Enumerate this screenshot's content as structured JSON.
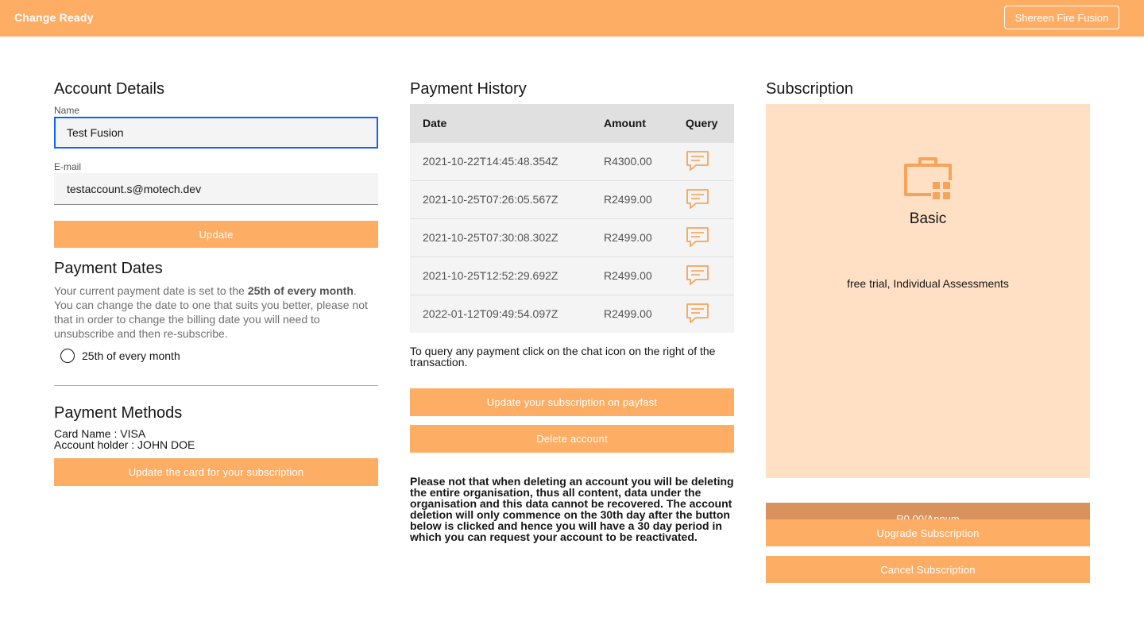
{
  "header": {
    "app_title": "Change Ready",
    "user_button": "Shereen Fire Fusion"
  },
  "account": {
    "heading": "Account Details",
    "name_label": "Name",
    "name_value": "Test Fusion",
    "email_label": "E-mail",
    "email_value": "testaccount.s@motech.dev",
    "update_button": "Update"
  },
  "payment_dates": {
    "heading": "Payment Dates",
    "text_before": "Your current payment date is set to the ",
    "text_bold": "25th of every month",
    "text_after": ". You can change the date to one that suits you better, please not that in order to change the billing date you will need to unsubscribe and then re-subscribe.",
    "option_label": "25th of every month"
  },
  "payment_methods": {
    "heading": "Payment Methods",
    "card_name": "Card Name : VISA",
    "account_holder": "Account holder : JOHN DOE",
    "update_card_button": "Update the card for your subscription"
  },
  "history": {
    "heading": "Payment History",
    "columns": [
      "Date",
      "Amount",
      "Query"
    ],
    "rows": [
      {
        "date": "2021-10-22T14:45:48.354Z",
        "amount": "R4300.00",
        "icon": "chat-icon"
      },
      {
        "date": "2021-10-25T07:26:05.567Z",
        "amount": "R2499.00",
        "icon": "chat-icon"
      },
      {
        "date": "2021-10-25T07:30:08.302Z",
        "amount": "R2499.00",
        "icon": "chat-icon"
      },
      {
        "date": "2021-10-25T12:52:29.692Z",
        "amount": "R2499.00",
        "icon": "chat-icon"
      },
      {
        "date": "2022-01-12T09:49:54.097Z",
        "amount": "R2499.00",
        "icon": "chat-icon"
      }
    ],
    "query_note": "To query any payment click on the chat icon on the right of the transaction.",
    "payfast_button": "Update your subscription on payfast",
    "delete_button": "Delete account",
    "delete_warning": "Please not that when deleting an account you will be deleting the entire organisation, thus all content, data under the organisation and this data cannot be recovered. The account deletion will only commence on the 30th day after the button below is clicked and hence you will have a 30 day period in which you can request your account to be reactivated."
  },
  "subscription": {
    "heading": "Subscription",
    "plan_icon": "briefcase-icon",
    "plan_name": "Basic",
    "plan_description": "free trial, Individual Assessments",
    "price": "R0.00/Annum",
    "upgrade_button": "Upgrade Subscription",
    "cancel_button": "Cancel Subscription"
  },
  "colors": {
    "accent": "#fead65",
    "accent_dark": "#d9925b",
    "card_bg": "#ffe0c4"
  }
}
